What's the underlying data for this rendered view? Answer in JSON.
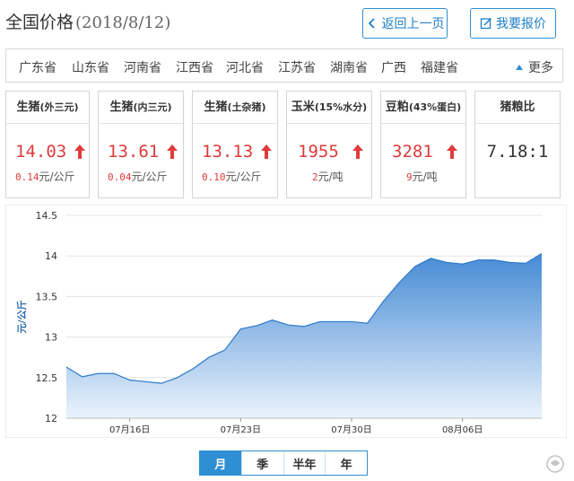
{
  "header": {
    "title": "全国价格",
    "date": "(2018/8/12)",
    "back_label": "返回上一页",
    "report_label": "我要报价"
  },
  "provinces": {
    "items": [
      "广东省",
      "山东省",
      "河南省",
      "江西省",
      "河北省",
      "江苏省",
      "湖南省",
      "广西",
      "福建省"
    ],
    "more_label": "更多"
  },
  "cards": [
    {
      "title": "生猪",
      "sub": "(外三元)",
      "value": "14.03",
      "change": "0.14",
      "unit": "元/公斤",
      "trend": "up"
    },
    {
      "title": "生猪",
      "sub": "(内三元)",
      "value": "13.61",
      "change": "0.04",
      "unit": "元/公斤",
      "trend": "up"
    },
    {
      "title": "生猪",
      "sub": "(土杂猪)",
      "value": "13.13",
      "change": "0.10",
      "unit": "元/公斤",
      "trend": "up"
    },
    {
      "title": "玉米",
      "sub": "(15%水分)",
      "value": "1955",
      "change": "2",
      "unit": "元/吨",
      "trend": "up"
    },
    {
      "title": "豆粕",
      "sub": "(43%蛋白)",
      "value": "3281",
      "change": "9",
      "unit": "元/吨",
      "trend": "up"
    }
  ],
  "ratio_card": {
    "title": "猪粮比",
    "value": "7.18:1"
  },
  "colors": {
    "accent": "#2f8fd4",
    "up": "#e03b3b",
    "area_top": "#3c84d2",
    "area_bottom": "#e9f3fc"
  },
  "chart_data": {
    "type": "area",
    "ylabel": "元/公斤",
    "ylim": [
      12,
      14.5
    ],
    "yticks": [
      "12",
      "12.5",
      "13",
      "13.5",
      "14",
      "14.5"
    ],
    "xticks": [
      {
        "label": "07月16日",
        "x": 4
      },
      {
        "label": "07月23日",
        "x": 11
      },
      {
        "label": "07月30日",
        "x": 18
      },
      {
        "label": "08月06日",
        "x": 25
      }
    ],
    "x": [
      0,
      1,
      2,
      3,
      4,
      5,
      6,
      7,
      8,
      9,
      10,
      11,
      12,
      13,
      14,
      15,
      16,
      17,
      18,
      19,
      20,
      21,
      22,
      23,
      24,
      25,
      26,
      27,
      28,
      29,
      30
    ],
    "values": [
      12.63,
      12.51,
      12.55,
      12.55,
      12.47,
      12.45,
      12.43,
      12.5,
      12.61,
      12.75,
      12.84,
      13.1,
      13.14,
      13.21,
      13.15,
      13.13,
      13.19,
      13.19,
      13.19,
      13.17,
      13.44,
      13.67,
      13.87,
      13.97,
      13.92,
      13.9,
      13.95,
      13.95,
      13.92,
      13.91,
      14.03
    ],
    "grid": true
  },
  "tabs": [
    {
      "label": "月",
      "active": true
    },
    {
      "label": "季",
      "active": false
    },
    {
      "label": "半年",
      "active": false
    },
    {
      "label": "年",
      "active": false
    }
  ],
  "watermark": "头条号 / 悟空问答"
}
